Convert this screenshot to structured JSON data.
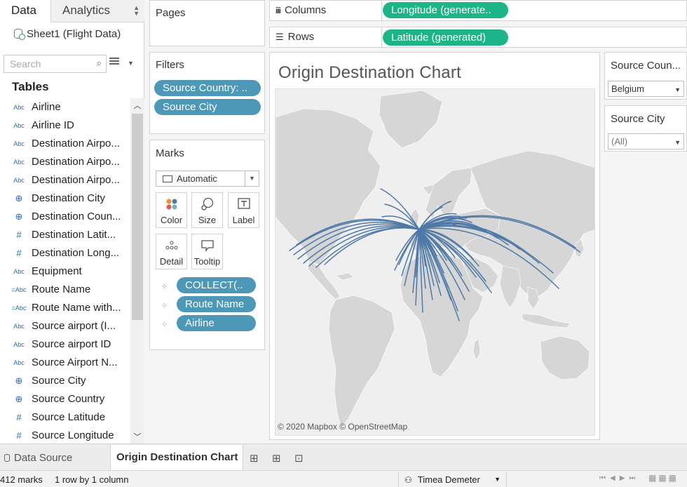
{
  "data_pane": {
    "tab_data": "Data",
    "tab_analytics": "Analytics",
    "data_source": "Sheet1 (Flight Data)",
    "search_placeholder": "Search",
    "tables_header": "Tables",
    "fields": [
      {
        "type": "Abc",
        "label": "Airline"
      },
      {
        "type": "Abc",
        "label": "Airline ID"
      },
      {
        "type": "Abc",
        "label": "Destination Airpo..."
      },
      {
        "type": "Abc",
        "label": "Destination Airpo..."
      },
      {
        "type": "Abc",
        "label": "Destination Airpo..."
      },
      {
        "type": "globe",
        "label": "Destination City"
      },
      {
        "type": "globe",
        "label": "Destination Coun..."
      },
      {
        "type": "#",
        "label": "Destination Latit..."
      },
      {
        "type": "#",
        "label": "Destination Long..."
      },
      {
        "type": "Abc",
        "label": "Equipment"
      },
      {
        "type": "=Abc",
        "label": "Route Name"
      },
      {
        "type": "=Abc",
        "label": "Route Name with..."
      },
      {
        "type": "Abc",
        "label": "Source airport (I..."
      },
      {
        "type": "Abc",
        "label": "Source airport ID"
      },
      {
        "type": "Abc",
        "label": "Source Airport N..."
      },
      {
        "type": "globe",
        "label": "Source City"
      },
      {
        "type": "globe",
        "label": "Source Country"
      },
      {
        "type": "#",
        "label": "Source Latitude"
      },
      {
        "type": "#",
        "label": "Source Longitude"
      }
    ]
  },
  "shelves": {
    "pages_title": "Pages",
    "filters_title": "Filters",
    "filters": [
      "Source Country: ..",
      "Source City"
    ],
    "columns_label": "Columns",
    "columns_pill": "Longitude (generate..",
    "rows_label": "Rows",
    "rows_pill": "Latitude (generated)"
  },
  "marks": {
    "title": "Marks",
    "mark_type": "Automatic",
    "buttons": {
      "color": "Color",
      "size": "Size",
      "label": "Label",
      "detail": "Detail",
      "tooltip": "Tooltip"
    },
    "pills": [
      "COLLECT(..",
      "Route Name",
      "Airline"
    ]
  },
  "view": {
    "title": "Origin Destination Chart",
    "attribution": "© 2020 Mapbox © OpenStreetMap",
    "route_color": "#4e79a7"
  },
  "quick_filters": {
    "country_title": "Source Coun...",
    "country_value": "Belgium",
    "city_title": "Source City",
    "city_value": "(All)"
  },
  "bottom": {
    "data_source_tab": "Data Source",
    "sheet_tab": "Origin Destination Chart"
  },
  "status": {
    "marks": "412 marks",
    "dims": "1 row by 1 column",
    "user": "Timea Demeter"
  }
}
